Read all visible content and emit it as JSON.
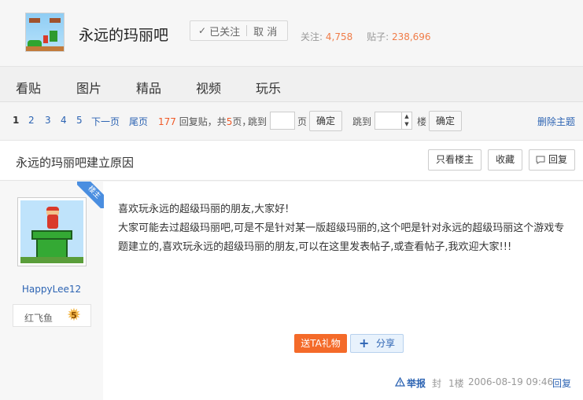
{
  "forum": {
    "name": "永远的玛丽吧",
    "follow_check": "✓",
    "follow_label": "已关注",
    "cancel_label": "取 消",
    "followers_label": "关注:",
    "followers": "4,758",
    "posts_label": "贴子:",
    "posts": "238,696"
  },
  "nav": {
    "items": [
      "看贴",
      "图片",
      "精品",
      "视频",
      "玩乐"
    ]
  },
  "pager": {
    "pages": [
      "1",
      "2",
      "3",
      "4",
      "5"
    ],
    "next": "下一页",
    "last": "尾页",
    "reply_count": "177",
    "reply_label": "回复贴，共",
    "page_count": "5",
    "page_unit": "页，",
    "jump_label": "跳到",
    "page_label": "页",
    "confirm": "确定",
    "jump_floor_label": "跳到",
    "floor_label": "楼",
    "confirm2": "确定",
    "delete_topic": "删除主题"
  },
  "thread": {
    "title": "永远的玛丽吧建立原因",
    "only_op": "只看楼主",
    "collect": "收藏",
    "reply_btn": "回复"
  },
  "post": {
    "corner_badge": "楼主",
    "author": "HappyLee12",
    "level_title": "红飞鱼",
    "level": "5",
    "line1": "喜欢玩永远的超级玛丽的朋友,大家好!",
    "line2": "大家可能去过超级玛丽吧,可是不是针对某一版超级玛丽的,这个吧是针对永远的超级玛丽这个游戏专题建立的,喜欢玩永远的超级玛丽的朋友,可以在这里发表帖子,或查看帖子,我欢迎大家!!!",
    "gift": "送TA礼物",
    "share_icon": "+",
    "share": "分享",
    "report": "举报",
    "seal": "封",
    "floor": "1楼",
    "date": "2006-08-19 09:46",
    "reply": "回复"
  }
}
